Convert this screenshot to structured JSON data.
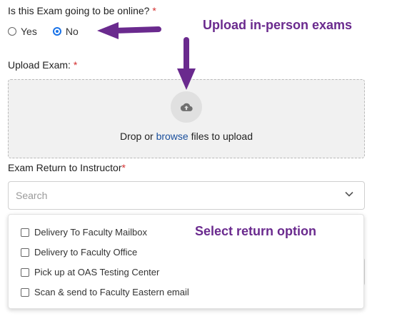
{
  "form": {
    "online_question": "Is this Exam going to be online?",
    "required_mark": "*",
    "online_options": [
      {
        "label": "Yes",
        "checked": false
      },
      {
        "label": "No",
        "checked": true
      }
    ],
    "upload_label": "Upload Exam:",
    "upload": {
      "drop_prefix": "Drop or",
      "browse_link": "browse",
      "drop_suffix": "files to upload",
      "icon": "cloud-upload-icon"
    },
    "return_label": "Exam Return to Instructor",
    "return_select": {
      "placeholder": "Search",
      "icon": "chevron-down-icon",
      "options": [
        {
          "label": "Delivery To Faculty Mailbox",
          "checked": false
        },
        {
          "label": "Delivery to Faculty Office",
          "checked": false
        },
        {
          "label": "Pick up at OAS Testing Center",
          "checked": false
        },
        {
          "label": "Scan & send to Faculty Eastern email",
          "checked": false
        }
      ]
    }
  },
  "annotations": {
    "upload_note": "Upload in-person exams",
    "return_note": "Select return option",
    "arrow_color": "#6a2a8e"
  }
}
